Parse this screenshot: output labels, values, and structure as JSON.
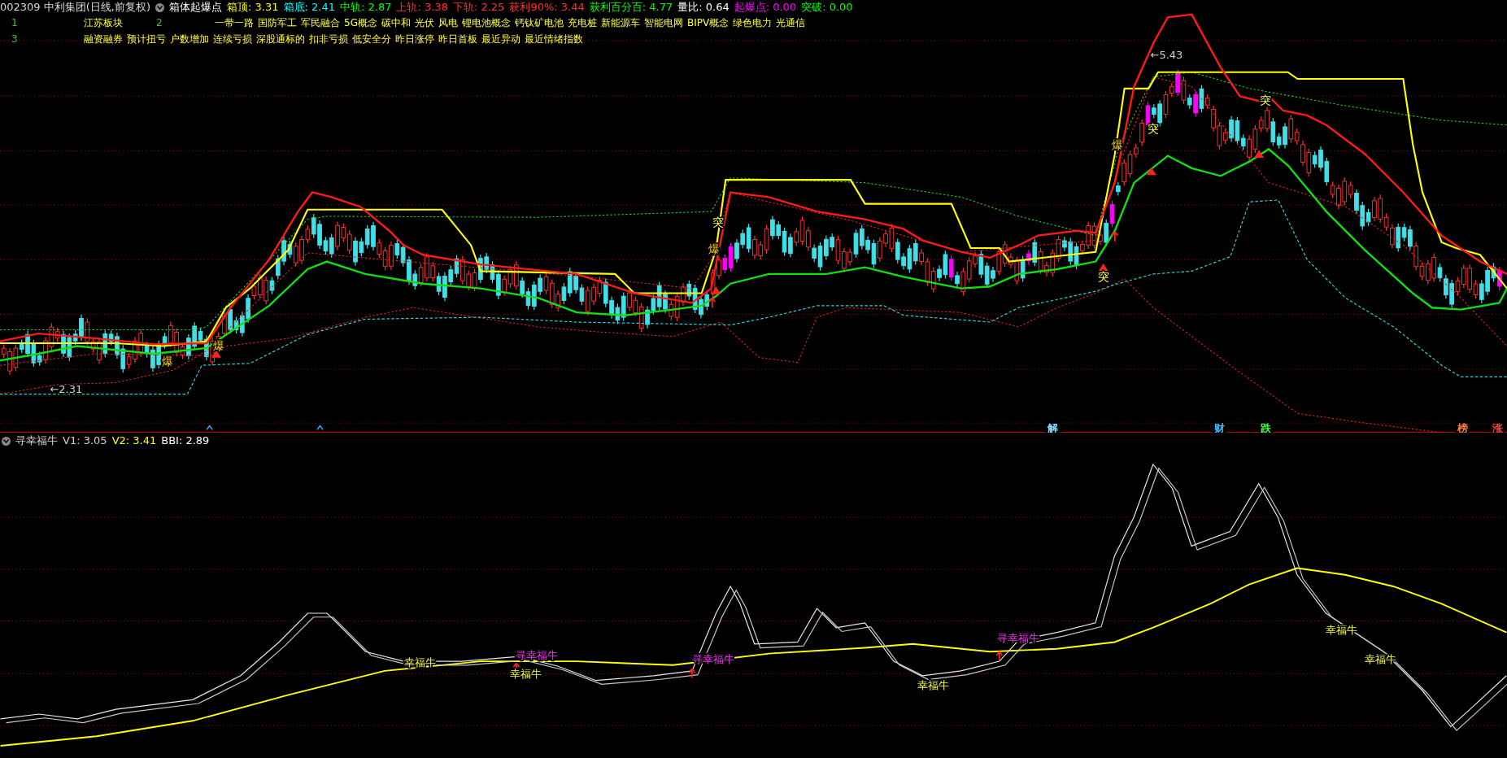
{
  "header": {
    "symbol": "002309 中利集团(日线,前复权)",
    "indicator": "箱体起爆点",
    "values": [
      {
        "label": "箱顶: 3.31",
        "color": "#ffff00"
      },
      {
        "label": "箱底: 2.41",
        "color": "#00ffff"
      },
      {
        "label": "中轨: 2.87",
        "color": "#00ff00"
      },
      {
        "label": "上轨: 3.38",
        "color": "#ff3030"
      },
      {
        "label": "下轨: 2.25",
        "color": "#ff3030"
      },
      {
        "label": "获利90%: 3.44",
        "color": "#ff3030"
      },
      {
        "label": "获利百分百: 4.77",
        "color": "#00ff00"
      },
      {
        "label": "量比: 0.64",
        "color": "#ffffff"
      },
      {
        "label": "起爆点: 0.00",
        "color": "#ff00ff"
      },
      {
        "label": "突破: 0.00",
        "color": "#00ff00"
      }
    ]
  },
  "info_rows": [
    {
      "index": "1",
      "sector": "江苏板块",
      "index2": "2",
      "tags": [
        "一带一路",
        "国防军工",
        "军民融合",
        "5G概念",
        "碳中和",
        "光伏",
        "风电",
        "锂电池概念",
        "钙钛矿电池",
        "充电桩",
        "新能源车",
        "智能电网",
        "BIPV概念",
        "绿色电力",
        "光通信"
      ]
    },
    {
      "index": "3",
      "tags": [
        "融资融券",
        "预计扭亏",
        "户数增加",
        "连续亏损",
        "深股通标的",
        "扣非亏损",
        "低安全分",
        "昨日涨停",
        "昨日首板",
        "最近异动",
        "最近情绪指数"
      ]
    }
  ],
  "main_chart": {
    "high_label": "←5.43",
    "low_label": "←2.31",
    "signals": [
      {
        "kind": "burst",
        "text": "爆"
      },
      {
        "kind": "burst",
        "text": "爆"
      },
      {
        "kind": "burst",
        "text": "爆"
      },
      {
        "kind": "burst",
        "text": "爆"
      },
      {
        "kind": "break",
        "text": "突"
      },
      {
        "kind": "break",
        "text": "突"
      },
      {
        "kind": "break",
        "text": "突"
      },
      {
        "kind": "break",
        "text": "突"
      }
    ],
    "bottom_marks": [
      {
        "text": "解",
        "color": "#80e0ff"
      },
      {
        "text": "财",
        "color": "#40c0ff"
      },
      {
        "text": "跌",
        "color": "#40ff40"
      },
      {
        "text": "榜",
        "color": "#ff8040"
      },
      {
        "text": "涨",
        "color": "#ff4040"
      }
    ]
  },
  "sub_chart": {
    "title": "寻幸福牛",
    "values": [
      {
        "label": "V1: 3.05",
        "color": "#d0d0d0"
      },
      {
        "label": "V2: 3.41",
        "color": "#ffff00"
      },
      {
        "label": "BBI: 2.89",
        "color": "#ffffff"
      }
    ],
    "labels": [
      {
        "kind": "signal",
        "text": "幸福牛"
      },
      {
        "kind": "search",
        "text": "寻幸福牛"
      },
      {
        "kind": "signal",
        "text": "幸福牛"
      },
      {
        "kind": "search",
        "text": "寻幸福牛"
      },
      {
        "kind": "signal",
        "text": "幸福牛"
      },
      {
        "kind": "search",
        "text": "寻幸福牛"
      },
      {
        "kind": "signal",
        "text": "幸福牛"
      },
      {
        "kind": "signal",
        "text": "幸福牛"
      }
    ]
  }
}
